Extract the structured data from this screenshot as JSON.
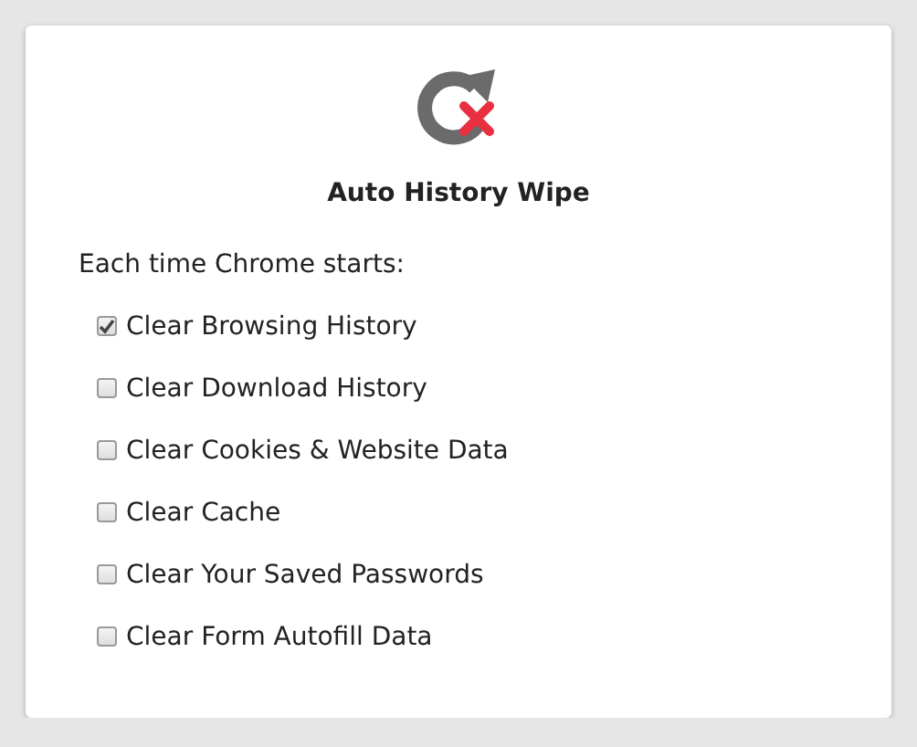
{
  "title": "Auto History Wipe",
  "intro": "Each time Chrome starts:",
  "options": [
    {
      "label": "Clear Browsing History",
      "checked": true
    },
    {
      "label": "Clear Download History",
      "checked": false
    },
    {
      "label": "Clear Cookies & Website Data",
      "checked": false
    },
    {
      "label": "Clear Cache",
      "checked": false
    },
    {
      "label": "Clear Your Saved Passwords",
      "checked": false
    },
    {
      "label": "Clear Form Autofill Data",
      "checked": false
    }
  ]
}
